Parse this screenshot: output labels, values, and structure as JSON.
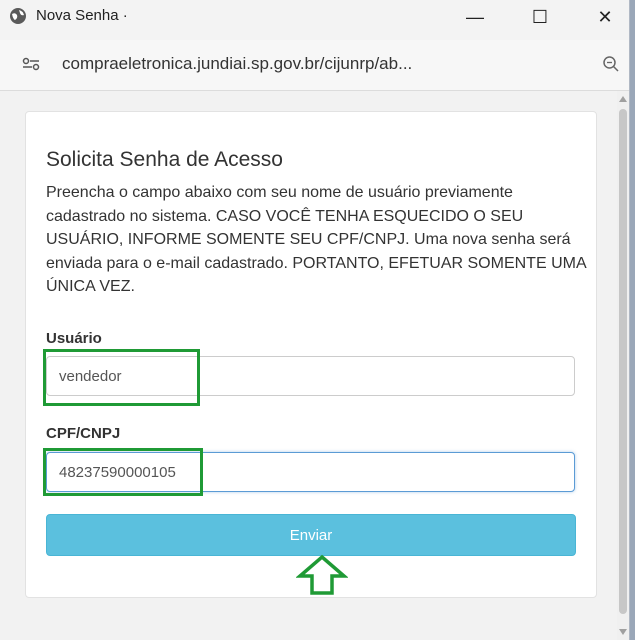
{
  "window": {
    "title": "Nova Senha ·",
    "controls": {
      "minimize": "—",
      "maximize": "☐",
      "close": "✕"
    }
  },
  "address_bar": {
    "url": "compraeletronica.jundiai.sp.gov.br/cijunrp/ab..."
  },
  "form": {
    "title": "Solicita Senha de Acesso",
    "description": "Preencha o campo abaixo com seu nome de usuário previamente cadastrado no sistema. CASO VOCÊ TENHA ESQUECIDO O SEU USUÁRIO, INFORME SOMENTE SEU CPF/CNPJ. Uma nova senha será enviada para o e-mail cadastrado. PORTANTO, EFETUAR SOMENTE UMA ÚNICA VEZ.",
    "user_label": "Usuário",
    "user_value": "vendedor",
    "cpf_label": "CPF/CNPJ",
    "cpf_value": "48237590000105",
    "submit_label": "Enviar"
  },
  "colors": {
    "highlight": "#1f9a35",
    "button": "#5bc0de"
  },
  "icons": {
    "title": "globe-icon",
    "site": "site-settings-icon",
    "zoom": "zoom-icon",
    "annotation": "arrow-up-outline-icon"
  }
}
